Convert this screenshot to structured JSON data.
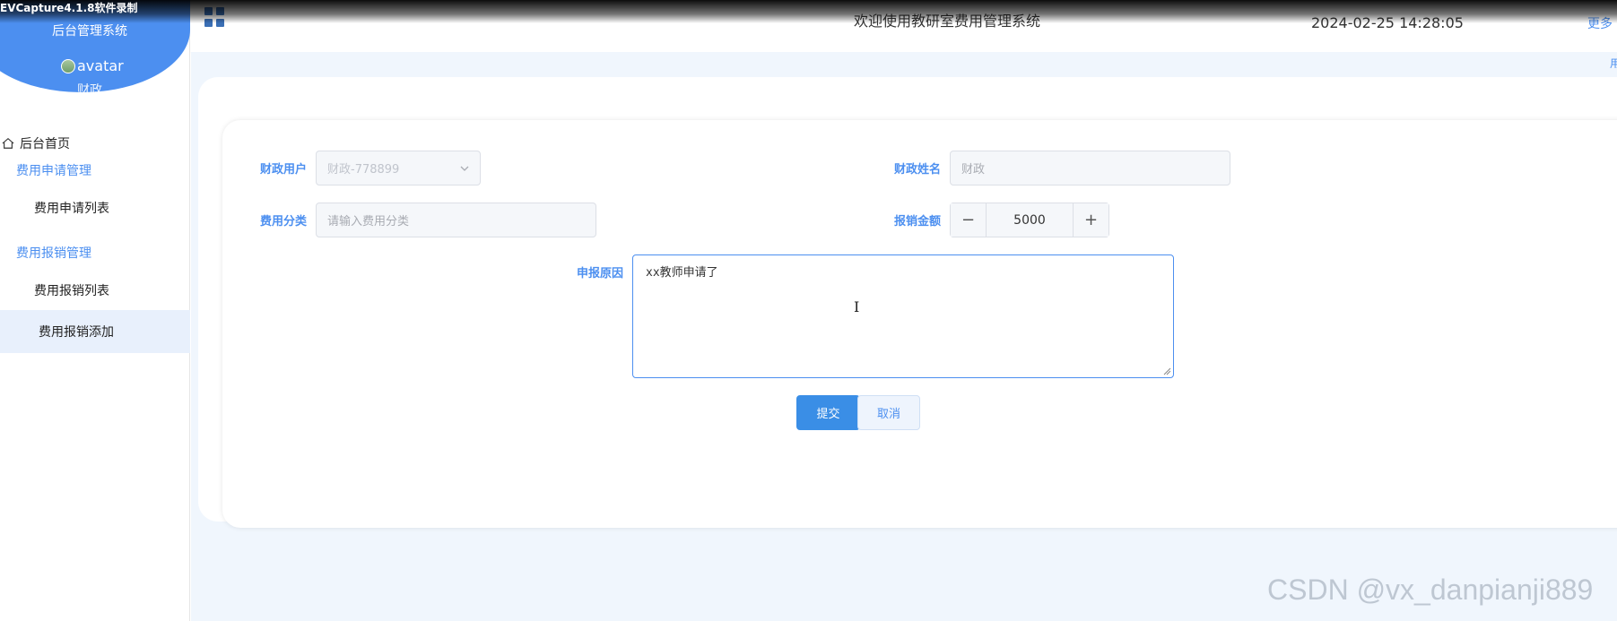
{
  "recorder": {
    "label": "EVCapture4.1.8软件录制"
  },
  "sidebar": {
    "system_title": "后台管理系统",
    "avatar_alt": "avatar",
    "user_role": "财政",
    "home_label": "后台首页",
    "groups": [
      {
        "label": "费用申请管理",
        "items": [
          {
            "label": "费用申请列表"
          }
        ]
      },
      {
        "label": "费用报销管理",
        "items": [
          {
            "label": "费用报销列表"
          },
          {
            "label": "费用报销添加",
            "active": true
          }
        ]
      }
    ]
  },
  "header": {
    "welcome": "欢迎使用教研室费用管理系统",
    "datetime": "2024-02-25 14:28:05",
    "more_link": "更多"
  },
  "edge_text": "用",
  "form": {
    "finance_user": {
      "label": "财政用户",
      "value": "财政-778899"
    },
    "finance_name": {
      "label": "财政姓名",
      "placeholder": "财政"
    },
    "category": {
      "label": "费用分类",
      "placeholder": "请输入费用分类"
    },
    "amount": {
      "label": "报销金额",
      "value": "5000",
      "minus": "−",
      "plus": "+"
    },
    "reason": {
      "label": "申报原因",
      "value": "xx教师申请了"
    },
    "submit_label": "提交",
    "cancel_label": "取消"
  },
  "watermark": "CSDN @vx_danpianji889",
  "colors": {
    "primary": "#4c8ff0",
    "submit": "#3a8ee6",
    "main_bg": "#f0f6fd"
  }
}
